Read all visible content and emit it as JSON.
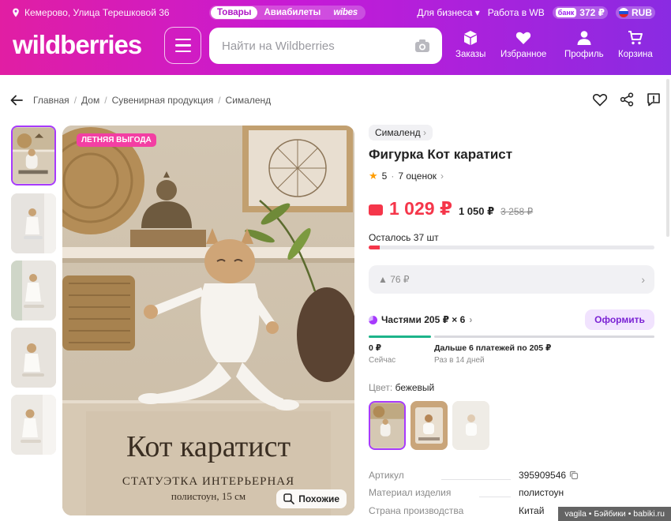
{
  "header": {
    "location": "Кемерово, Улица Терешковой 36",
    "segments": [
      "Товары",
      "Авиабилеты",
      "wibes"
    ],
    "for_business": "Для бизнеса",
    "work": "Работа в WB",
    "bank_label": "банк",
    "balance": "372 ₽",
    "currency": "RUB",
    "logo": "wildberries",
    "search_placeholder": "Найти на Wildberries",
    "nav": {
      "orders": "Заказы",
      "favorites": "Избранное",
      "profile": "Профиль",
      "cart": "Корзина"
    }
  },
  "breadcrumbs": [
    "Главная",
    "Дом",
    "Сувенирная продукция",
    "Сималенд"
  ],
  "gallery": {
    "promo_badge": "ЛЕТНЯЯ ВЫГОДА",
    "caption_title": "Кот каратист",
    "caption_sub": "СТАТУЭТКА ИНТЕРЬЕРНАЯ",
    "caption_sub2": "полистоун, 15 см",
    "similar_button": "Похожие"
  },
  "product": {
    "brand": "Сималенд",
    "title": "Фигурка Кот каратист",
    "rating": "5",
    "reviews": "7 оценок",
    "price_wallet": "1 029 ₽",
    "price_regular": "1 050 ₽",
    "price_old": "3 258 ₽",
    "remaining": "Осталось 37 шт",
    "remaining_fraction": 0.04,
    "delivery_value": "▲ 76 ₽",
    "installment": "Частями 205 ₽ × 6",
    "order_button": "Оформить",
    "pay_now": "0 ₽",
    "pay_now_sub": "Сейчас",
    "pay_later": "Дальше 6 платежей по 205 ₽",
    "pay_later_sub": "Раз в 14 дней",
    "color_label": "Цвет:",
    "color_value": "бежевый"
  },
  "specs": [
    {
      "key": "Артикул",
      "value": "395909546"
    },
    {
      "key": "Материал изделия",
      "value": "полистоун"
    },
    {
      "key": "Страна производства",
      "value": "Китай"
    }
  ],
  "watermark": "vagila • Бэйбики • babiki.ru",
  "colors": {
    "accent": "#a73afd",
    "price": "#f5364a",
    "header_from": "#e11ea3",
    "header_to": "#8a2be2"
  }
}
